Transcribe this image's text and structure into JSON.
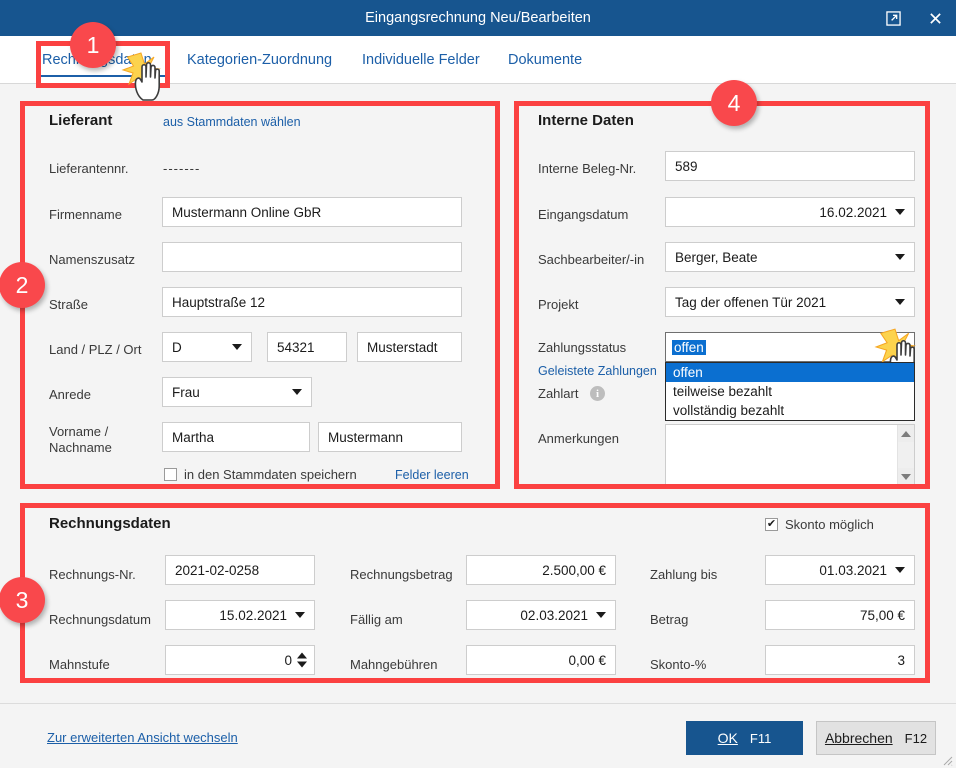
{
  "window": {
    "title": "Eingangsrechnung Neu/Bearbeiten",
    "popout_icon": "popout-icon",
    "close_icon": "close-icon",
    "titlebar_color": "#17558f"
  },
  "tabs": [
    {
      "label": "Rechnungsdaten",
      "active": true
    },
    {
      "label": "Kategorien-Zuordnung",
      "active": false
    },
    {
      "label": "Individuelle Felder",
      "active": false
    },
    {
      "label": "Dokumente",
      "active": false
    }
  ],
  "supplier": {
    "title": "Lieferant",
    "choose_link": "aus Stammdaten wählen",
    "labels": {
      "supplier_no": "Lieferantennr.",
      "company": "Firmenname",
      "name_addition": "Namenszusatz",
      "street": "Straße",
      "country_zip_city": "Land / PLZ / Ort",
      "salutation": "Anrede",
      "first_last_name_1": "Vorname /",
      "first_last_name_2": "Nachname"
    },
    "values": {
      "supplier_no": "-------",
      "company": "Mustermann Online GbR",
      "name_addition": "",
      "street": "Hauptstraße 12",
      "country": "D",
      "zip": "54321",
      "city": "Musterstadt",
      "salutation": "Frau",
      "first_name": "Martha",
      "last_name": "Mustermann"
    },
    "save_checkbox_label": "in den Stammdaten speichern",
    "save_checkbox_checked": false,
    "clear_link": "Felder leeren"
  },
  "internal": {
    "title": "Interne Daten",
    "labels": {
      "doc_no": "Interne Beleg-Nr.",
      "receipt_date": "Eingangsdatum",
      "clerk": "Sachbearbeiter/-in",
      "project": "Projekt",
      "payment_status": "Zahlungsstatus",
      "payments_made_link": "Geleistete Zahlungen",
      "payment_type": "Zahlart",
      "notes": "Anmerkungen"
    },
    "values": {
      "doc_no": "589",
      "receipt_date": "16.02.2021",
      "clerk": "Berger, Beate",
      "project": "Tag der offenen Tür 2021",
      "payment_status": "offen",
      "notes": ""
    },
    "payment_status_options": [
      "offen",
      "teilweise bezahlt",
      "vollständig bezahlt"
    ],
    "payment_status_open": true,
    "info_icon_glyph": "i"
  },
  "invoice": {
    "title": "Rechnungsdaten",
    "skonto_checkbox_label": "Skonto möglich",
    "skonto_checked": true,
    "labels": {
      "invoice_no": "Rechnungs-Nr.",
      "invoice_date": "Rechnungsdatum",
      "dunning_level": "Mahnstufe",
      "invoice_amount": "Rechnungsbetrag",
      "due_on": "Fällig am",
      "dunning_fees": "Mahngebühren",
      "payment_until": "Zahlung bis",
      "amount": "Betrag",
      "skonto_percent": "Skonto-%"
    },
    "values": {
      "invoice_no": "2021-02-0258",
      "invoice_date": "15.02.2021",
      "dunning_level": "0",
      "invoice_amount": "2.500,00 €",
      "due_on": "02.03.2021",
      "dunning_fees": "0,00 €",
      "payment_until": "01.03.2021",
      "amount": "75,00 €",
      "skonto_percent": "3"
    }
  },
  "footer": {
    "switch_link": "Zur erweiterten Ansicht wechseln",
    "ok_label": "OK",
    "ok_key": "F11",
    "cancel_label": "Abbrechen",
    "cancel_key": "F12"
  },
  "annotations": {
    "badges": [
      "1",
      "2",
      "3",
      "4"
    ],
    "color": "#f9484c"
  }
}
